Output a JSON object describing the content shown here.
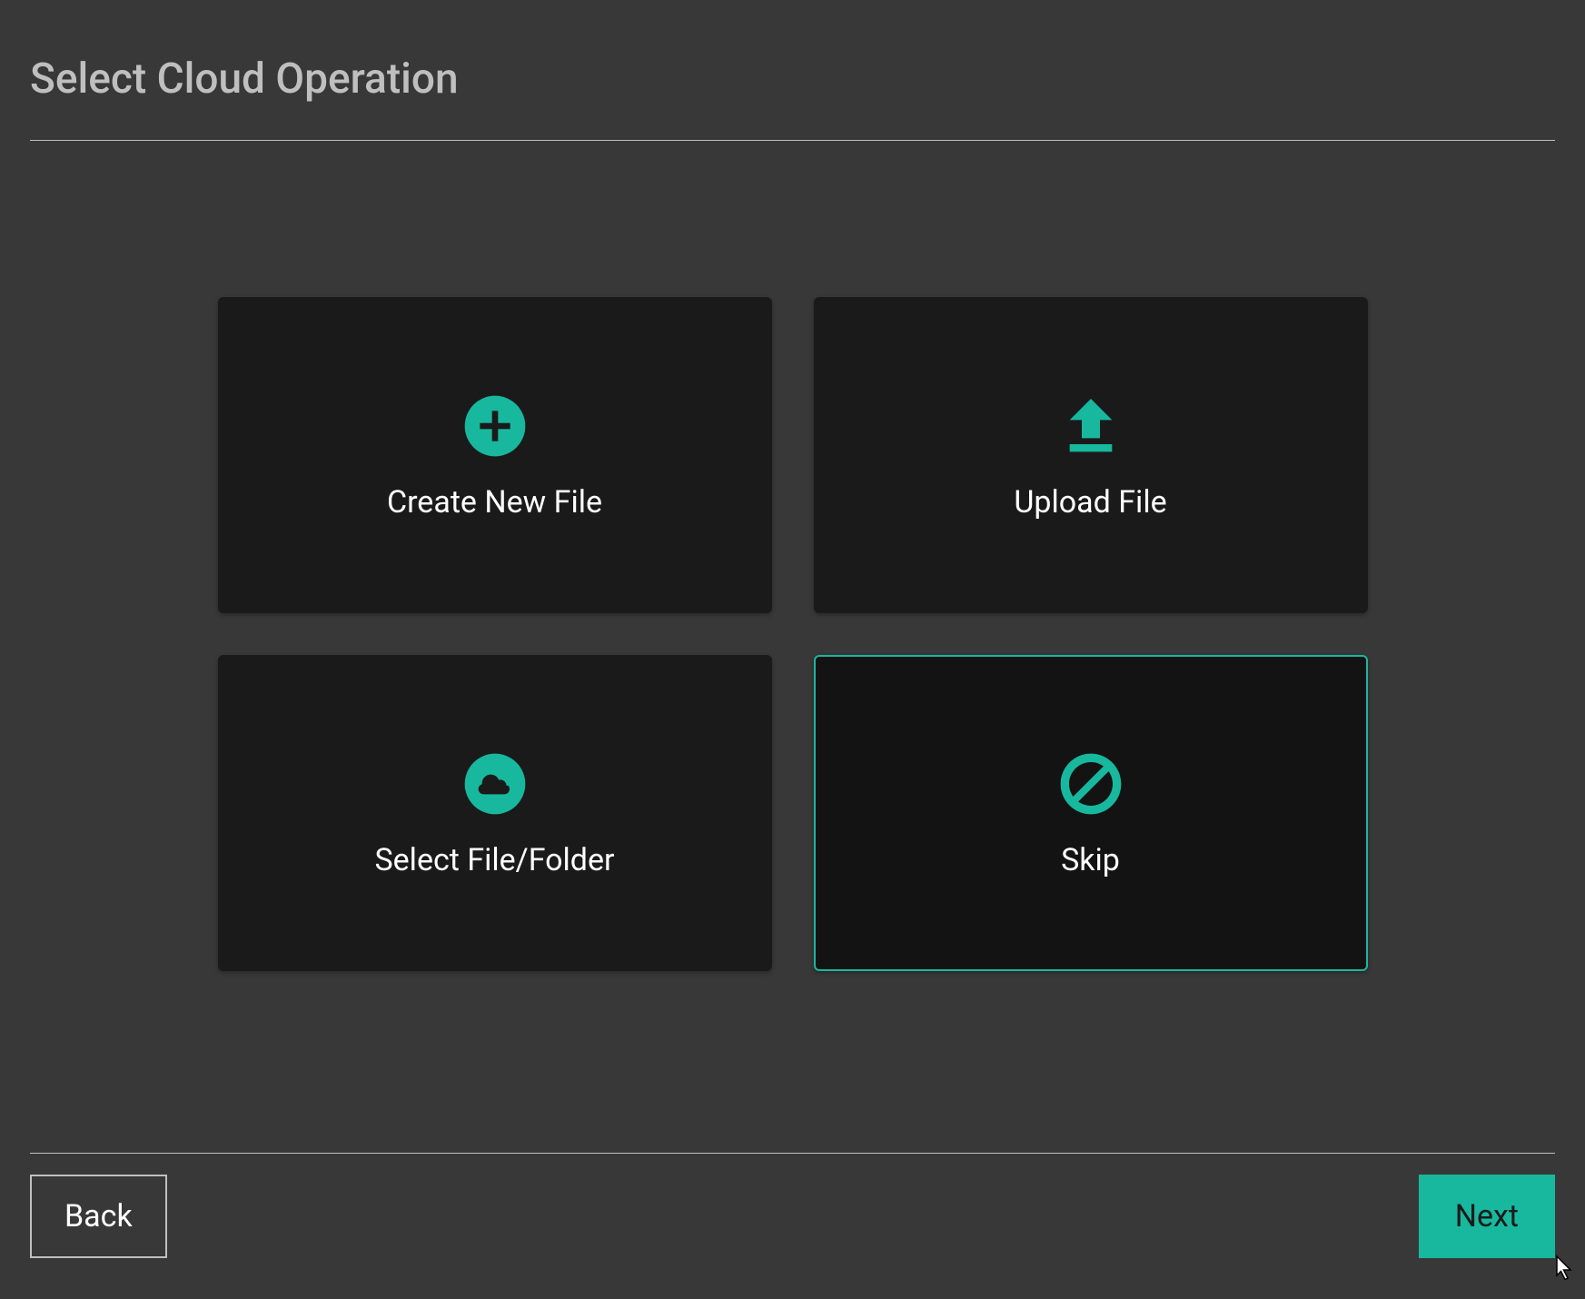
{
  "header": {
    "title": "Select Cloud Operation"
  },
  "options": {
    "create": {
      "label": "Create New File",
      "selected": false
    },
    "upload": {
      "label": "Upload File",
      "selected": false
    },
    "select": {
      "label": "Select File/Folder",
      "selected": false
    },
    "skip": {
      "label": "Skip",
      "selected": true
    }
  },
  "footer": {
    "back_label": "Back",
    "next_label": "Next"
  },
  "colors": {
    "accent": "#18b89e",
    "background": "#383838",
    "card_background": "#1a1a1a",
    "text_light": "#bfbfbf",
    "text_white": "#ffffff"
  }
}
